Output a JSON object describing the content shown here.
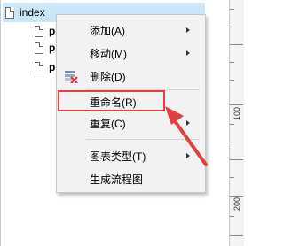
{
  "tree": {
    "root_label": "index",
    "children": [
      "p",
      "p",
      "p"
    ]
  },
  "ruler": {
    "labels": [
      "100",
      "200"
    ]
  },
  "context_menu": {
    "items": [
      {
        "label": "添加(A)",
        "submenu": true
      },
      {
        "label": "移动(M)",
        "submenu": true
      },
      {
        "label": "删除(D)",
        "submenu": false,
        "icon": "delete-icon"
      },
      {
        "label": "重命名(R)",
        "submenu": false,
        "highlighted": true
      },
      {
        "label": "重复(C)",
        "submenu": true
      },
      {
        "label": "图表类型(T)",
        "submenu": true
      },
      {
        "label": "生成流程图",
        "submenu": false
      }
    ]
  },
  "colors": {
    "selection": "#cce6f7",
    "highlight": "#e0403f",
    "menu_bg": "#f2f2f2"
  }
}
